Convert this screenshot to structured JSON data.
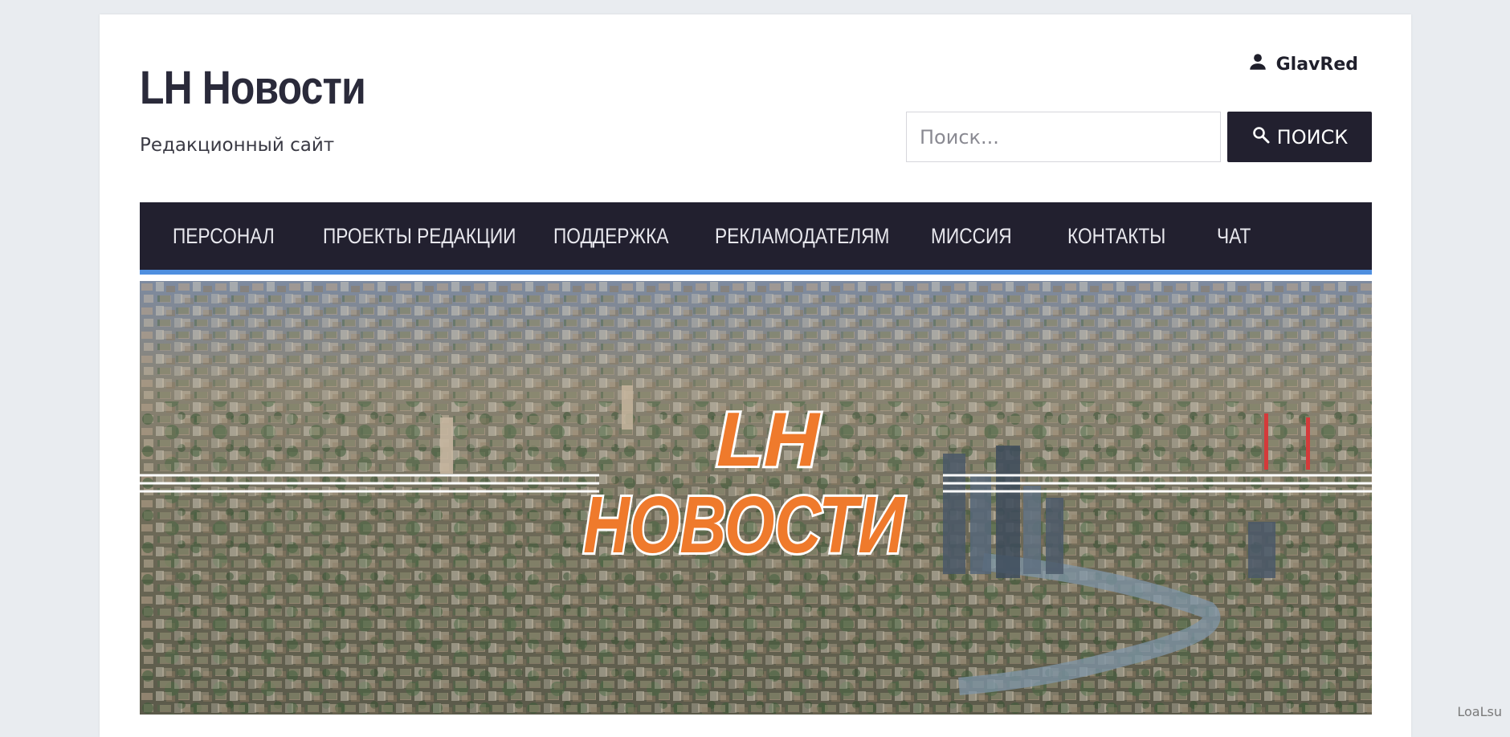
{
  "site": {
    "title": "LH Новости",
    "tagline": "Редакционный сайт"
  },
  "user": {
    "name": "GlavRed",
    "icon": "user-icon"
  },
  "search": {
    "placeholder": "Поиск...",
    "button_label": "ПОИСК",
    "button_icon": "search-icon"
  },
  "nav": {
    "items": [
      {
        "label": "ПЕРСОНАЛ"
      },
      {
        "label": "ПРОЕКТЫ РЕДАКЦИИ"
      },
      {
        "label": "ПОДДЕРЖКА"
      },
      {
        "label": "РЕКЛАМОДАТЕЛЯМ"
      },
      {
        "label": "МИССИЯ"
      },
      {
        "label": "КОНТАКТЫ"
      },
      {
        "label": "ЧАТ"
      }
    ]
  },
  "banner": {
    "logo_line1": "LH",
    "logo_line2": "НОВОСТИ"
  },
  "watermark": "LoaLsu",
  "colors": {
    "nav_bg": "#22202f",
    "nav_accent": "#4f8fdf",
    "logo_orange": "#ef7a2c",
    "page_bg": "#e9ecf0"
  }
}
